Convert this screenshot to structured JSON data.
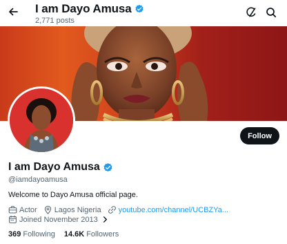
{
  "header": {
    "name": "I am Dayo Amusa",
    "posts": "2,771 posts"
  },
  "profile": {
    "display_name": "I am Dayo Amusa",
    "handle": "@iamdayoamusa",
    "bio": "Welcome to Dayo Amusa official page.",
    "category": "Actor",
    "location": "Lagos Nigeria",
    "website": "youtube.com/channel/UCBZYa...",
    "joined": "Joined November 2013",
    "follow_label": "Follow"
  },
  "stats": {
    "following_count": "369",
    "following_label": "Following",
    "followers_count": "14.6K",
    "followers_label": "Followers"
  },
  "colors": {
    "verified": "#1d9bf0",
    "link": "#1d9bf0",
    "muted_text": "#536471",
    "primary_text": "#0f1419"
  },
  "icons": {
    "back": "arrow-left-icon",
    "grok": "grok-icon",
    "search": "search-icon",
    "verified": "verified-badge-icon",
    "category": "briefcase-icon",
    "location": "location-pin-icon",
    "website": "link-icon",
    "joined": "calendar-icon",
    "expand": "chevron-right-icon"
  }
}
